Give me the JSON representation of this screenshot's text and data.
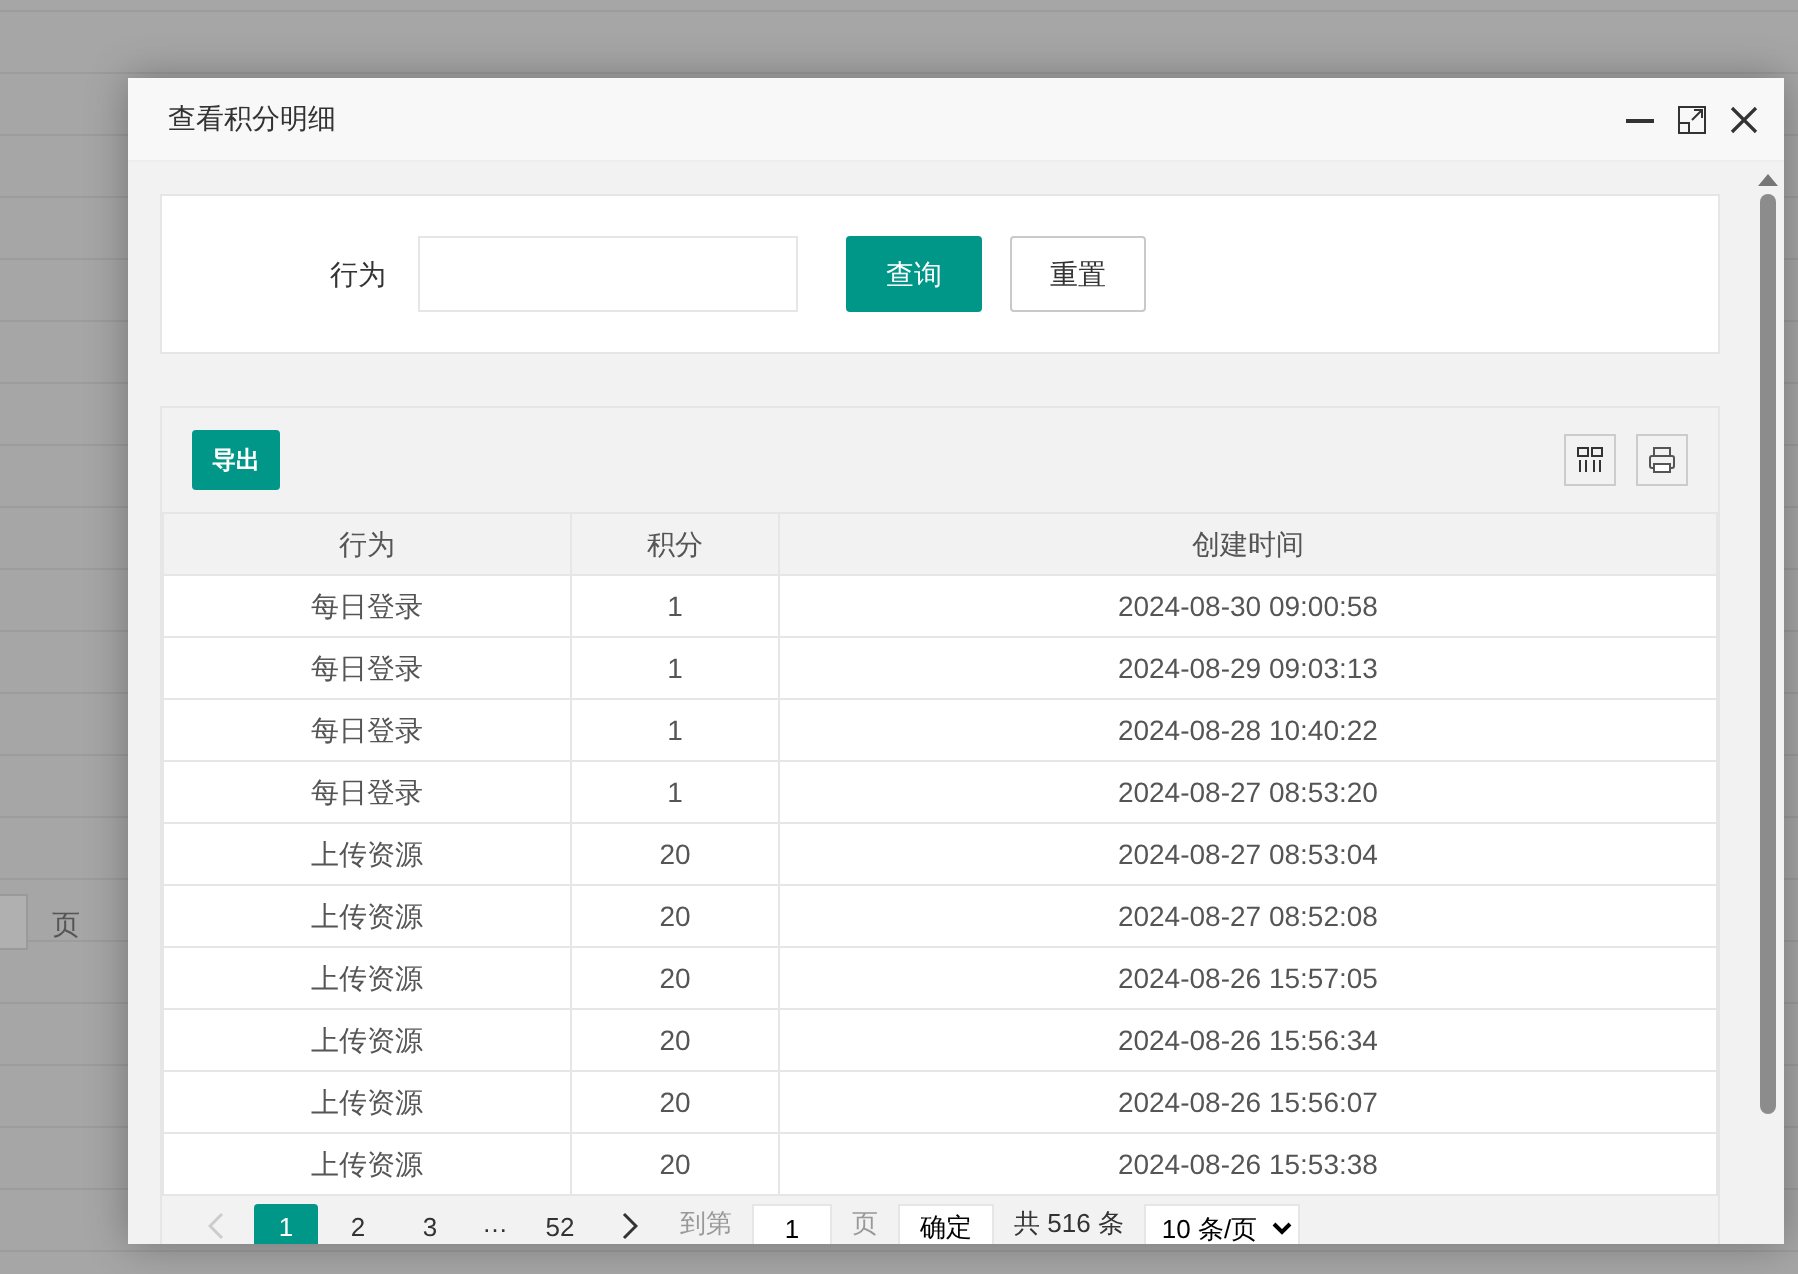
{
  "background_page": {
    "page_unit": "页"
  },
  "dialog": {
    "title": "查看积分明细"
  },
  "search": {
    "label": "行为",
    "buttons": [
      {
        "label": "查询",
        "kind": "primary"
      },
      {
        "label": "重置",
        "kind": "plain"
      }
    ]
  },
  "toolbar": {
    "export": "导出"
  },
  "table": {
    "columns": [
      "行为",
      "积分",
      "创建时间"
    ],
    "rows": [
      [
        "每日登录",
        "1",
        "2024-08-30 09:00:58"
      ],
      [
        "每日登录",
        "1",
        "2024-08-29 09:03:13"
      ],
      [
        "每日登录",
        "1",
        "2024-08-28 10:40:22"
      ],
      [
        "每日登录",
        "1",
        "2024-08-27 08:53:20"
      ],
      [
        "上传资源",
        "20",
        "2024-08-27 08:53:04"
      ],
      [
        "上传资源",
        "20",
        "2024-08-27 08:52:08"
      ],
      [
        "上传资源",
        "20",
        "2024-08-26 15:57:05"
      ],
      [
        "上传资源",
        "20",
        "2024-08-26 15:56:34"
      ],
      [
        "上传资源",
        "20",
        "2024-08-26 15:56:07"
      ],
      [
        "上传资源",
        "20",
        "2024-08-26 15:53:38"
      ]
    ]
  },
  "pagination": {
    "prev_disabled": true,
    "pages": [
      {
        "label": "1",
        "selected": true
      },
      {
        "label": "2",
        "selected": false
      },
      {
        "label": "3",
        "selected": false
      },
      {
        "label": "…",
        "kind": "ellipsis"
      },
      {
        "label": "52",
        "selected": false
      }
    ],
    "goto_label": "到第",
    "goto_value": "1",
    "page_unit": "页",
    "confirm": "确定",
    "total": "共 516 条",
    "page_size": "10 条/页"
  }
}
